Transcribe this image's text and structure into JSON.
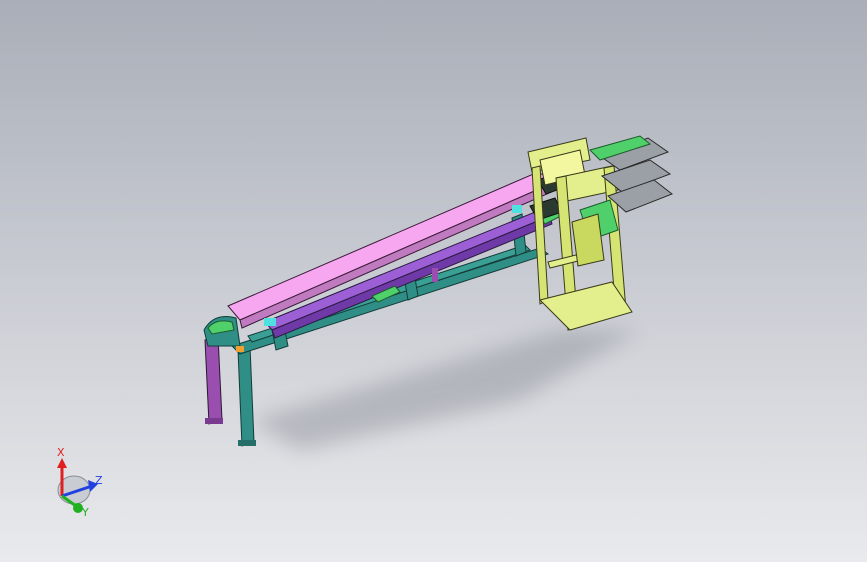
{
  "viewport": {
    "background_top": "#a9aeb8",
    "background_bottom": "#e9eaed"
  },
  "model": {
    "colors": {
      "belt_pink": "#f7a6f0",
      "belt_purple": "#9c5fd6",
      "frame_teal": "#2f8f86",
      "leg_purple": "#9a4fb0",
      "hopper_yellow": "#e2ef8c",
      "roller_green": "#4fd06a",
      "chute_gray": "#9aa0a6",
      "cyan_part": "#4fe0e0",
      "orange_part": "#f0a030"
    }
  },
  "triad": {
    "x_label": "X",
    "y_label": "Y",
    "z_label": "Z",
    "x_color": "#e02020",
    "y_color": "#20b020",
    "z_color": "#2040e0"
  }
}
